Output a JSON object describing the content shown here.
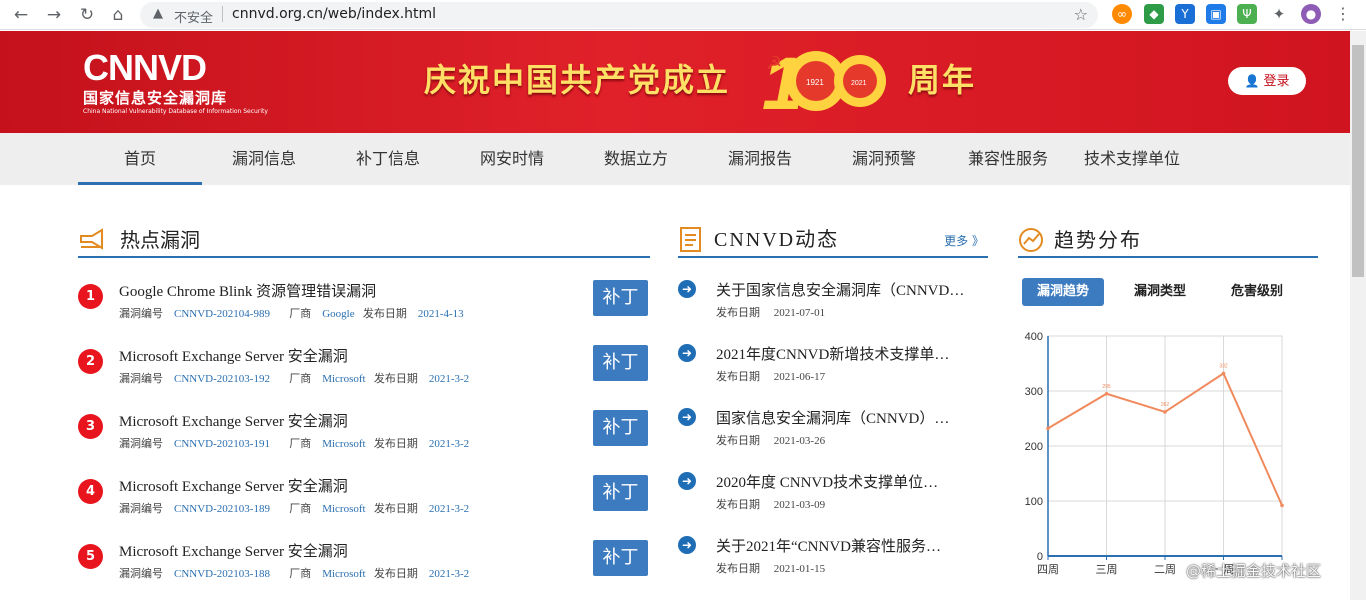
{
  "browser": {
    "insecure_label": "不安全",
    "url": "cnnvd.org.cn/web/index.html"
  },
  "header": {
    "logo_mark": "CNNVD",
    "logo_cn": "国家信息安全漏洞库",
    "logo_en": "China National Vulnerability Database of Information Security",
    "banner_left": "庆祝中国共产党成立",
    "banner_years": [
      "1921",
      "2021"
    ],
    "banner_right": "周年",
    "login_label": "登录",
    "brand_color": "#d0141f"
  },
  "nav": {
    "items": [
      "首页",
      "漏洞信息",
      "补丁信息",
      "网安时情",
      "数据立方",
      "漏洞报告",
      "漏洞预警",
      "兼容性服务",
      "技术支撑单位"
    ],
    "active_index": 0
  },
  "hot": {
    "title": "热点漏洞",
    "id_label": "漏洞编号",
    "vendor_label": "厂商",
    "date_label": "发布日期",
    "patch_label": "补丁",
    "items": [
      {
        "rank": "1",
        "title": "Google Chrome Blink 资源管理错误漏洞",
        "id": "CNNVD-202104-989",
        "vendor": "Google",
        "date": "2021-4-13"
      },
      {
        "rank": "2",
        "title": "Microsoft Exchange Server 安全漏洞",
        "id": "CNNVD-202103-192",
        "vendor": "Microsoft",
        "date": "2021-3-2"
      },
      {
        "rank": "3",
        "title": "Microsoft Exchange Server 安全漏洞",
        "id": "CNNVD-202103-191",
        "vendor": "Microsoft",
        "date": "2021-3-2"
      },
      {
        "rank": "4",
        "title": "Microsoft Exchange Server 安全漏洞",
        "id": "CNNVD-202103-189",
        "vendor": "Microsoft",
        "date": "2021-3-2"
      },
      {
        "rank": "5",
        "title": "Microsoft Exchange Server 安全漏洞",
        "id": "CNNVD-202103-188",
        "vendor": "Microsoft",
        "date": "2021-3-2"
      }
    ]
  },
  "news": {
    "title": "CNNVD动态",
    "more": "更多 》",
    "date_label": "发布日期",
    "items": [
      {
        "title": "关于国家信息安全漏洞库（CNNVD…",
        "date": "2021-07-01"
      },
      {
        "title": "2021年度CNNVD新增技术支撑单…",
        "date": "2021-06-17"
      },
      {
        "title": "国家信息安全漏洞库（CNNVD）…",
        "date": "2021-03-26"
      },
      {
        "title": "2020年度 CNNVD技术支撑单位…",
        "date": "2021-03-09"
      },
      {
        "title": "关于2021年“CNNVD兼容性服务…",
        "date": "2021-01-15"
      }
    ]
  },
  "trend": {
    "title": "趋势分布",
    "tabs": [
      "漏洞趋势",
      "漏洞类型",
      "危害级别"
    ],
    "active_tab": 0
  },
  "chart_data": {
    "type": "line",
    "categories": [
      "四周",
      "三周",
      "二周",
      "一周",
      ""
    ],
    "series": [
      {
        "values": [
          232,
          295,
          262,
          332,
          92
        ],
        "color": "#f08a5d"
      }
    ],
    "point_labels": [
      "",
      "295",
      "262",
      "332",
      ""
    ],
    "ylim": [
      0,
      400
    ],
    "yticks": [
      "0",
      "100",
      "200",
      "300",
      "400"
    ],
    "grid": true
  },
  "watermark": "@稀土掘金技术社区"
}
